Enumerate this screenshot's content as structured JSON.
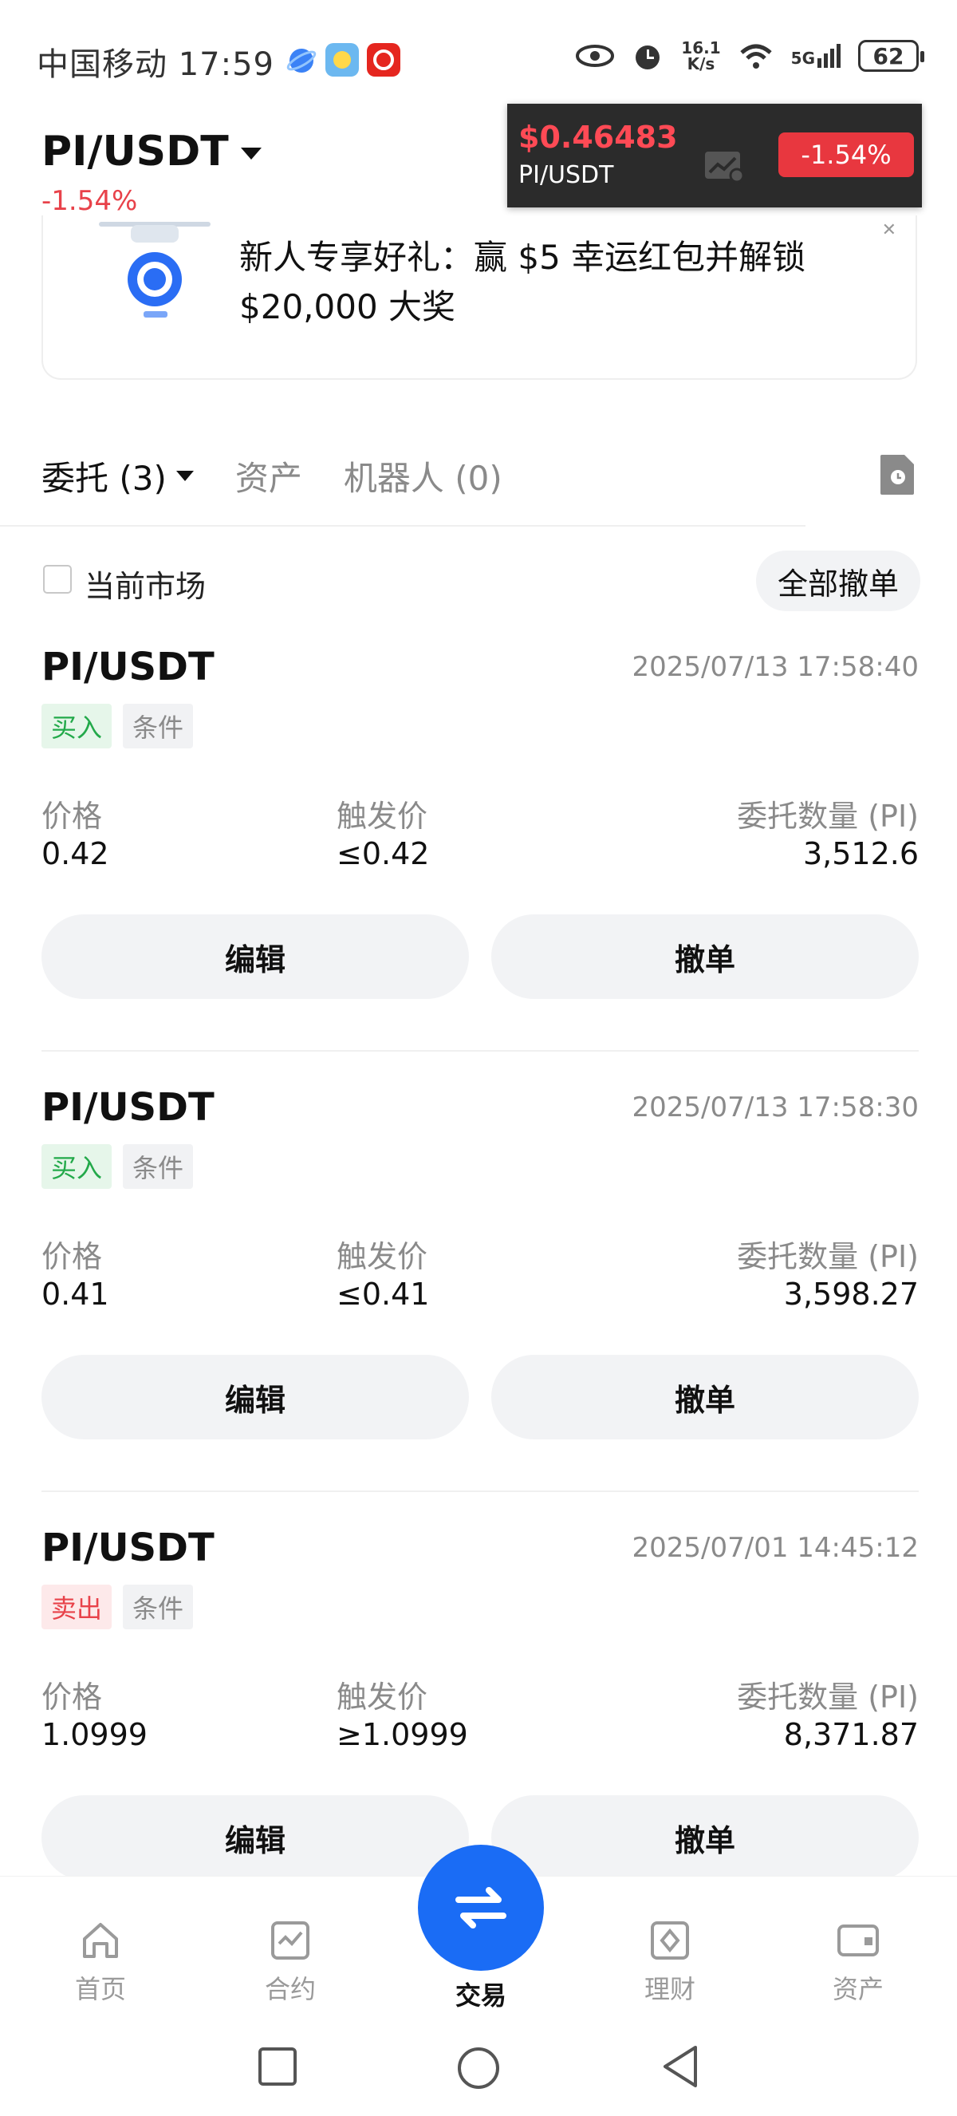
{
  "status_bar": {
    "carrier_time": "中国移动 17:59",
    "net_speed_top": "16.1",
    "net_speed_bottom": "K/s",
    "signal": "5G",
    "battery": "62"
  },
  "header": {
    "pair": "PI/USDT",
    "change": "-1.54%"
  },
  "ticker": {
    "price": "$0.46483",
    "symbol": "PI/USDT",
    "change": "-1.54%"
  },
  "banner": {
    "text": "新人专享好礼：赢 $5 幸运红包并解锁 $20,000 大奖"
  },
  "tabs": {
    "orders": "委托 (3)",
    "assets": "资产",
    "bots": "机器人 (0)"
  },
  "filter": {
    "current_market": "当前市场",
    "cancel_all": "全部撤单"
  },
  "labels": {
    "price": "价格",
    "trigger": "触发价",
    "quantity": "委托数量 (PI)",
    "edit": "编辑",
    "cancel": "撤单",
    "condition": "条件"
  },
  "orders": [
    {
      "pair": "PI/USDT",
      "time": "2025/07/13 17:58:40",
      "side": "买入",
      "price": "0.42",
      "trigger": "≤0.42",
      "quantity": "3,512.6"
    },
    {
      "pair": "PI/USDT",
      "time": "2025/07/13 17:58:30",
      "side": "买入",
      "price": "0.41",
      "trigger": "≤0.41",
      "quantity": "3,598.27"
    },
    {
      "pair": "PI/USDT",
      "time": "2025/07/01 14:45:12",
      "side": "卖出",
      "price": "1.0999",
      "trigger": "≥1.0999",
      "quantity": "8,371.87"
    }
  ],
  "bottom_nav": {
    "home": "首页",
    "futures": "合约",
    "trade": "交易",
    "finance": "理财",
    "assets": "资产"
  },
  "colors": {
    "accent": "#1a6cf5",
    "down": "#e8424a",
    "buy": "#23a94a"
  }
}
